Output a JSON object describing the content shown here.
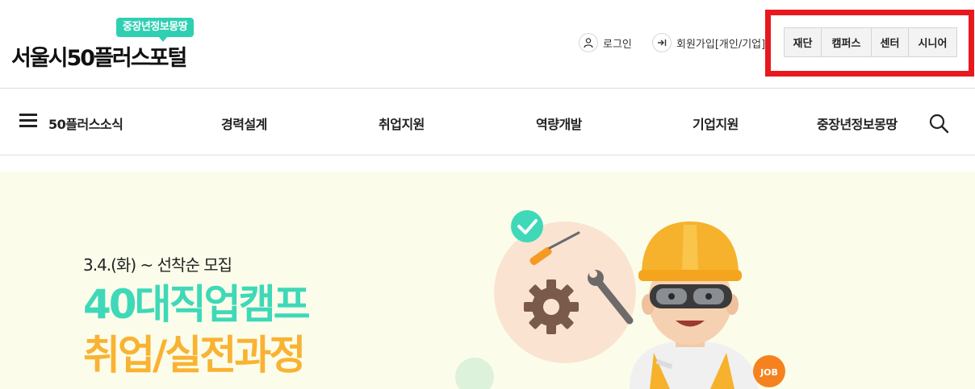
{
  "header": {
    "logo_badge": "중장년정보몽땅",
    "logo_title": "서울시50플러스포털",
    "login_label": "로그인",
    "join_label": "회원가입[개인/기업]",
    "site_links": [
      "재단",
      "캠퍼스",
      "센터",
      "시니어"
    ]
  },
  "nav": {
    "menu_label": "50플러스소식",
    "items": [
      "경력설계",
      "취업지원",
      "역량개발",
      "기업지원",
      "중장년정보몽땅"
    ]
  },
  "banner": {
    "subtitle": "3.4.(화) ~ 선착순 모집",
    "title_line1": "40대직업캠프",
    "title_line2": "취업/실전과정",
    "badge_text": "JOB"
  },
  "colors": {
    "accent_mint": "#3fd8b8",
    "accent_orange": "#f9b233",
    "highlight_red": "#e8181f",
    "banner_bg": "#fbfdea"
  }
}
